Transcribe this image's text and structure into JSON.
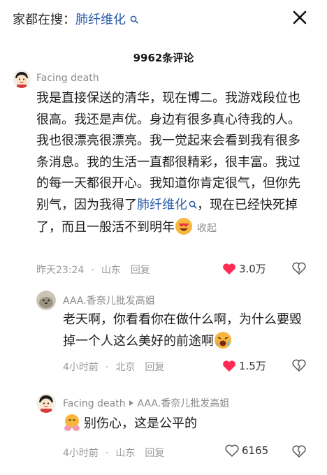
{
  "search": {
    "prefix": "家都在搜：",
    "keyword": "肺纤维化"
  },
  "comments_header": {
    "count_label": "9962条评论"
  },
  "comments": [
    {
      "author": "Facing death",
      "text_before_link": "我是直接保送的清华，现在博二。我游戏段位也很高。我还是声优。身边有很多真心待我的人。我也很漂亮很漂亮。我一觉起来会看到我有很多条消息。我的生活一直都很精彩，很丰富。我过的每一天都很开心。我知道你肯定很气，但你先别气，因为我得了",
      "link_text": "肺纤维化",
      "text_after_link": "，现在已经快死掉了，而且一般活不到明年",
      "collapse_label": "收起",
      "time": "昨天23:24",
      "location": "山东",
      "reply_label": "回复",
      "likes": "3.0万",
      "liked": true,
      "avatar_icon": "cartoon-boy-avatar"
    },
    {
      "author": "AAA.香奈儿批发高姐",
      "text": "老天啊，你看看你在做什么啊，为什么要毁掉一个人这么美好的前途啊",
      "time": "4小时前",
      "location": "北京",
      "reply_label": "回复",
      "likes": "1.5万",
      "liked": true,
      "avatar_icon": "seal-avatar"
    },
    {
      "author": "Facing death",
      "reply_to": "AAA.香奈儿批发高姐",
      "text": "别伤心，这是公平的",
      "time": "4小时前",
      "location": "山东",
      "reply_label": "回复",
      "likes": "6165",
      "liked": false,
      "avatar_icon": "cartoon-boy-avatar"
    }
  ],
  "colors": {
    "link": "#2a5caa",
    "like_active": "#fe2c55",
    "muted": "#9a9a9a"
  }
}
